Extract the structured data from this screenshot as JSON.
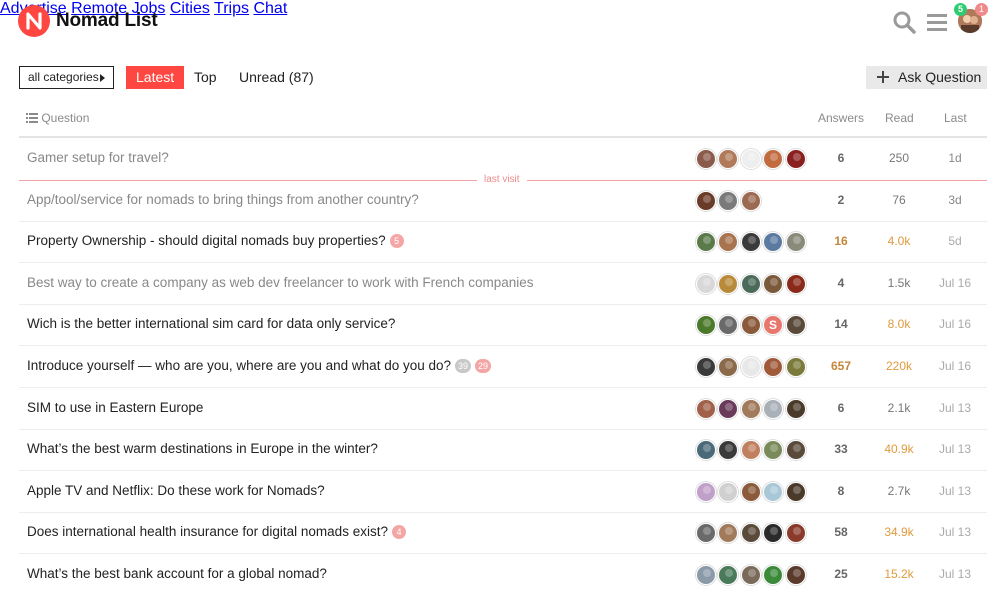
{
  "brand": {
    "name": "Nomad List",
    "accent": "#ff4742"
  },
  "nav": [
    "Advertise",
    "Remote Jobs",
    "Cities",
    "Trips",
    "Chat"
  ],
  "header_icons": [
    "search-icon",
    "menu-icon"
  ],
  "user": {
    "notifications_green": "5",
    "notifications_red": "1"
  },
  "filters": {
    "category": "all categories",
    "tabs": [
      "Latest",
      "Top",
      "Unread (87)"
    ],
    "active_tab": "Latest",
    "ask_button": "Ask Question"
  },
  "columns": {
    "question": "Question",
    "answers": "Answers",
    "read": "Read",
    "last": "Last"
  },
  "last_visit_label": "last visit",
  "topics": [
    {
      "title": "Gamer setup for travel?",
      "visited": true,
      "pills": [],
      "answers": "6",
      "read": "250",
      "last": "1d",
      "hot_answers": false,
      "hot_read": false,
      "avatars": [
        "#8a5a4a",
        "#b07a5a",
        "#eeeeee",
        "#c26b3f",
        "#8a1f1f"
      ]
    },
    {
      "title": "App/tool/service for nomads to bring things from another country?",
      "visited": true,
      "pills": [],
      "answers": "2",
      "read": "76",
      "last": "3d",
      "hot_answers": false,
      "hot_read": false,
      "avatars": [
        "#6b3b2a",
        "#7a7a7a",
        "#9b6a52"
      ]
    },
    {
      "title": "Property Ownership - should digital nomads buy properties?",
      "visited": false,
      "pills": [
        {
          "text": "5",
          "tone": "red"
        }
      ],
      "answers": "16",
      "read": "4.0k",
      "last": "5d",
      "hot_answers": true,
      "hot_read": true,
      "avatars": [
        "#5a7a4a",
        "#a8744f",
        "#3a3a3a",
        "#5a7aa0",
        "#8a8a7a"
      ]
    },
    {
      "title": "Best way to create a company as web dev freelancer to work with French companies",
      "visited": true,
      "pills": [],
      "answers": "4",
      "read": "1.5k",
      "last": "Jul 16",
      "hot_answers": false,
      "hot_read": false,
      "avatars": [
        "#d8d8d8",
        "#b88a3a",
        "#4a6a5a",
        "#7a5a3a",
        "#8a2a1a"
      ]
    },
    {
      "title": "Wich is the better international sim card for data only service?",
      "visited": false,
      "pills": [],
      "answers": "14",
      "read": "8.0k",
      "last": "Jul 16",
      "hot_answers": false,
      "hot_read": true,
      "avatars": [
        "#4a7a2a",
        "#6a6a6a",
        "#8a5a3a",
        "S",
        "#5a4a3a"
      ]
    },
    {
      "title": "Introduce yourself — who are you, where are you and what do you do?",
      "visited": false,
      "pills": [
        {
          "text": "39",
          "tone": "grey"
        },
        {
          "text": "29",
          "tone": "red"
        }
      ],
      "answers": "657",
      "read": "220k",
      "last": "Jul 16",
      "hot_answers": true,
      "hot_read": true,
      "avatars": [
        "#3a3a3a",
        "#8a6a4a",
        "#e8e8e8",
        "#a05a3a",
        "#7a7a3a"
      ]
    },
    {
      "title": "SIM to use in Eastern Europe",
      "visited": false,
      "pills": [],
      "answers": "6",
      "read": "2.1k",
      "last": "Jul 13",
      "hot_answers": false,
      "hot_read": false,
      "avatars": [
        "#a0604a",
        "#6a3a5a",
        "#a07a5a",
        "#aab0b8",
        "#4a3a2a"
      ]
    },
    {
      "title": "What’s the best warm destinations in Europe in the winter?",
      "visited": false,
      "pills": [],
      "answers": "33",
      "read": "40.9k",
      "last": "Jul 13",
      "hot_answers": false,
      "hot_read": true,
      "avatars": [
        "#4a6a7a",
        "#3a3a3a",
        "#c08060",
        "#7a8a5a",
        "#5a4a3a"
      ]
    },
    {
      "title": "Apple TV and Netflix: Do these work for Nomads?",
      "visited": false,
      "pills": [],
      "answers": "8",
      "read": "2.7k",
      "last": "Jul 13",
      "hot_answers": false,
      "hot_read": false,
      "avatars": [
        "#c0a0c8",
        "#d0d0d0",
        "#8a5a3a",
        "#a8c8d8",
        "#4a3a2a"
      ]
    },
    {
      "title": "Does international health insurance for digital nomads exist?",
      "visited": false,
      "pills": [
        {
          "text": "4",
          "tone": "red"
        }
      ],
      "answers": "58",
      "read": "34.9k",
      "last": "Jul 13",
      "hot_answers": false,
      "hot_read": true,
      "avatars": [
        "#6a6a6a",
        "#a07a5a",
        "#5a4a3a",
        "#2a2a2a",
        "#8a3a2a"
      ]
    },
    {
      "title": "What’s the best bank account for a global nomad?",
      "visited": false,
      "pills": [],
      "answers": "25",
      "read": "15.2k",
      "last": "Jul 13",
      "hot_answers": false,
      "hot_read": true,
      "avatars": [
        "#8a9aa8",
        "#4a7a5a",
        "#7a6a5a",
        "#3a8a3a",
        "#5a3a2a"
      ]
    }
  ]
}
